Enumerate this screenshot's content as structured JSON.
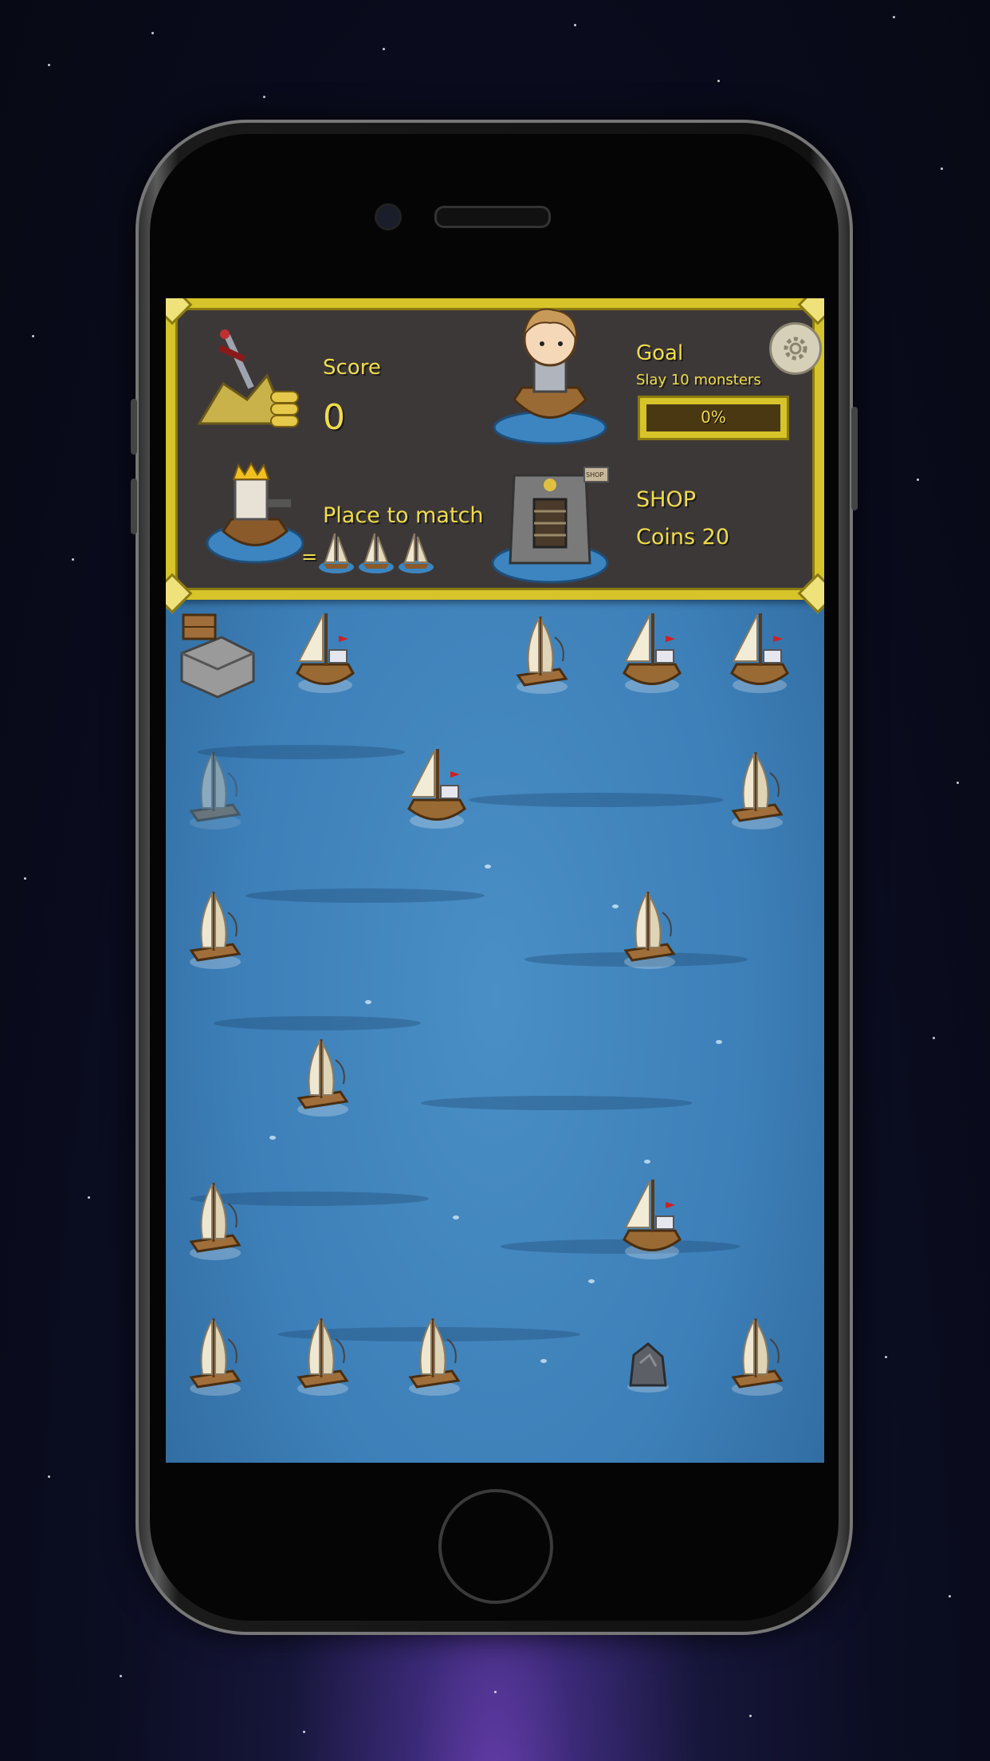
{
  "hud": {
    "score_label": "Score",
    "score_value": "0",
    "place_label": "Place to match",
    "equals_sign": "=",
    "goal_label": "Goal",
    "goal_desc": "Slay 10 monsters",
    "goal_progress_text": "0%",
    "goal_progress_fraction": 0,
    "shop_label": "SHOP",
    "coins_label": "Coins 20",
    "shop_sign": "SHOP"
  },
  "board": {
    "rows": [
      [
        "fortress",
        "sailboat",
        "empty",
        "raft",
        "sailboat",
        "sailboat"
      ],
      [
        "raft-ghost",
        "empty",
        "sailboat",
        "empty",
        "empty",
        "raft"
      ],
      [
        "raft",
        "empty",
        "empty",
        "empty",
        "raft",
        "empty"
      ],
      [
        "empty",
        "raft",
        "empty",
        "empty",
        "empty",
        "empty"
      ],
      [
        "raft",
        "empty",
        "empty",
        "empty",
        "sailboat",
        "empty"
      ],
      [
        "raft",
        "raft",
        "raft",
        "empty",
        "rock",
        "raft"
      ]
    ]
  },
  "colors": {
    "hud_frame": "#d6c42a",
    "hud_bg": "#3d3838",
    "hud_text": "#f0dc4a",
    "sea": "#3d7fb8"
  }
}
